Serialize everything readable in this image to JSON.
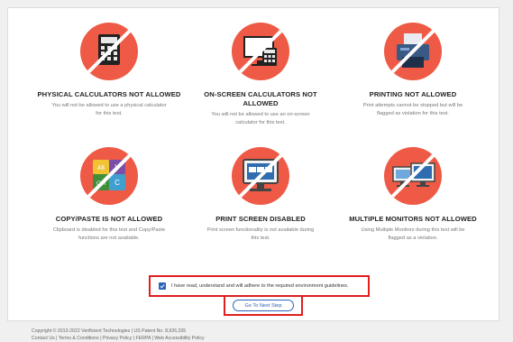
{
  "rules": [
    {
      "title_lines": [
        "PHYSICAL CALCULATORS NOT ALLOWED"
      ],
      "desc_lines": [
        "You will not be allowed to use a physical calculator",
        "for this test."
      ],
      "icon": "calculator-icon"
    },
    {
      "title_lines": [
        "ON-SCREEN CALCULATORS NOT",
        "ALLOWED"
      ],
      "desc_lines": [
        "You will not be allowed to use an on-screen",
        "calculator for this test."
      ],
      "icon": "onscreen-calculator-icon"
    },
    {
      "title_lines": [
        "PRINTING NOT ALLOWED"
      ],
      "desc_lines": [
        "Print attempts cannot be stopped but will be",
        "flagged as violation for this test."
      ],
      "icon": "printer-icon"
    },
    {
      "title_lines": [
        "COPY/PASTE IS NOT ALLOWED"
      ],
      "desc_lines": [
        "Clipboard is disabled for this test and Copy/Paste",
        "functions are not available."
      ],
      "icon": "keyboard-keys-icon"
    },
    {
      "title_lines": [
        "PRINT SCREEN DISABLED"
      ],
      "desc_lines": [
        "Print screen functionality is not available during",
        "this test."
      ],
      "icon": "monitor-screenshot-icon"
    },
    {
      "title_lines": [
        "MULTIPLE MONITORS NOT ALLOWED"
      ],
      "desc_lines": [
        "Using Multiple Monitors during this test will be",
        "flagged as a violation."
      ],
      "icon": "multiple-monitors-icon"
    }
  ],
  "keys": {
    "alt": "Alt",
    "v": "V",
    "ctrl": "Ctrl",
    "c": "C"
  },
  "agreement": {
    "label": "I have read, understand and will adhere to the required environment guidelines.",
    "checked": true
  },
  "next_button": "Go To Next Step",
  "footer": {
    "line1": "Copyright © 2013-2022 Verificient Technologies | US Patent No. 8,926,335",
    "line2": "Contact Us  |  Terms & Conditions  |  Privacy Policy  |  FERPA  |  Web Accessibility Policy"
  },
  "colors": {
    "circle": "#ee5a45",
    "accent": "#2b63b8",
    "highlight": "#e01e1e"
  }
}
